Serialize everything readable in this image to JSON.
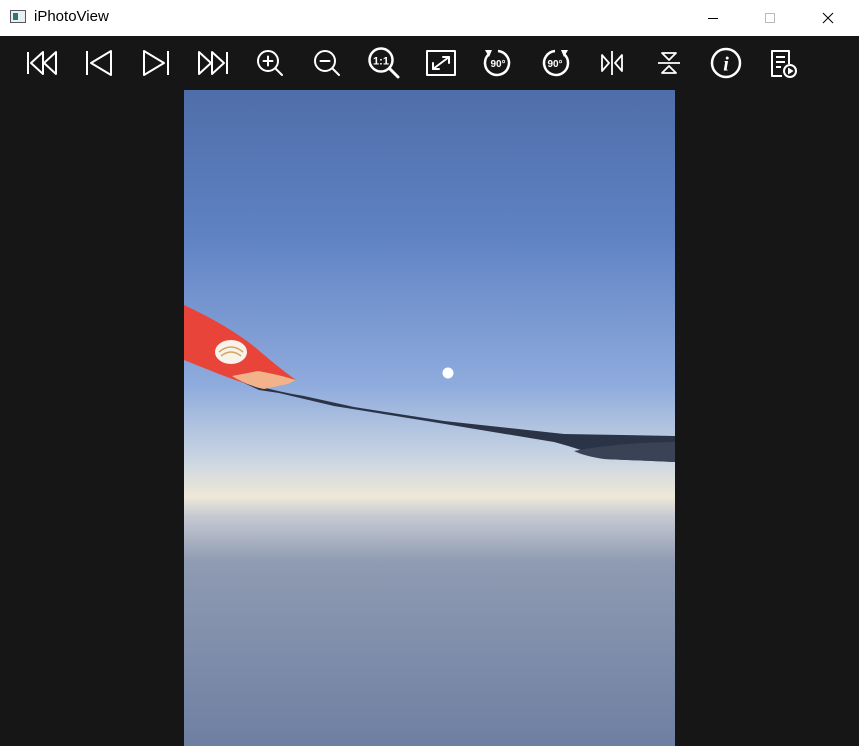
{
  "window": {
    "title": "iPhotoView",
    "controls": [
      "minimize-icon",
      "maximize-icon",
      "close-icon"
    ]
  },
  "toolbar": {
    "buttons": [
      {
        "icon": "first-image-icon"
      },
      {
        "icon": "previous-image-icon"
      },
      {
        "icon": "next-image-icon"
      },
      {
        "icon": "last-image-icon"
      },
      {
        "icon": "zoom-in-icon"
      },
      {
        "icon": "zoom-out-icon"
      },
      {
        "icon": "actual-size-icon",
        "label": "1:1"
      },
      {
        "icon": "fit-to-window-icon"
      },
      {
        "icon": "rotate-left-icon",
        "label": "90°"
      },
      {
        "icon": "rotate-right-icon",
        "label": "90°"
      },
      {
        "icon": "flip-horizontal-icon"
      },
      {
        "icon": "flip-vertical-icon"
      },
      {
        "icon": "info-icon",
        "label": "i"
      },
      {
        "icon": "slideshow-icon"
      }
    ]
  },
  "colors": {
    "toolbar_bg": "#161616",
    "icon": "#ffffff",
    "titlebar_bg": "#ffffff"
  }
}
